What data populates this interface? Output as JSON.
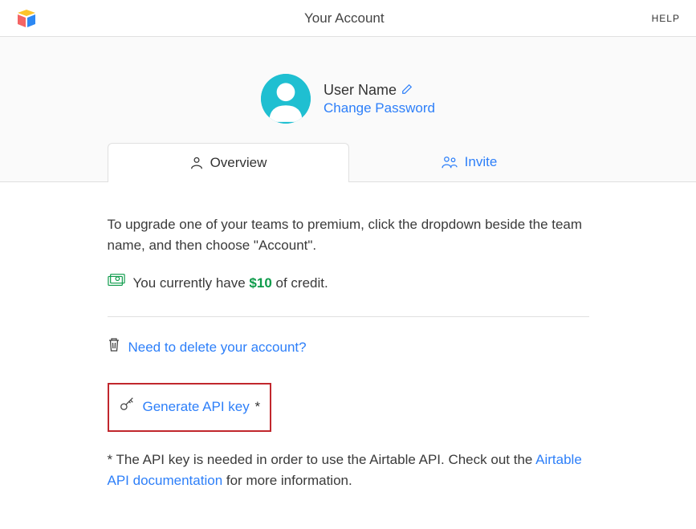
{
  "header": {
    "title": "Your Account",
    "help": "HELP"
  },
  "profile": {
    "username": "User Name",
    "change_password": "Change Password"
  },
  "tabs": {
    "overview": "Overview",
    "invite": "Invite"
  },
  "content": {
    "upgrade_text": "To upgrade one of your teams to premium, click the dropdown beside the team name, and then choose \"Account\".",
    "credit_prefix": "You currently have ",
    "credit_amount": "$10",
    "credit_suffix": " of credit.",
    "delete_account": "Need to delete your account?",
    "generate_api_key": "Generate API key",
    "asterisk": "*",
    "footnote_prefix": "* The API key is needed in order to use the Airtable API. Check out the ",
    "footnote_link": "Airtable API documentation",
    "footnote_suffix": " for more information."
  }
}
